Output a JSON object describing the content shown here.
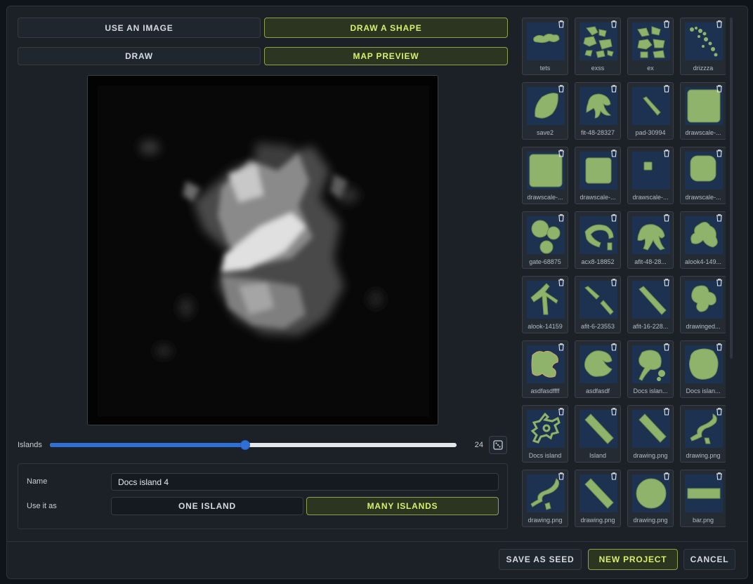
{
  "source_tabs": [
    {
      "label": "USE AN IMAGE",
      "active": false
    },
    {
      "label": "DRAW A SHAPE",
      "active": true
    }
  ],
  "mode_tabs": [
    {
      "label": "DRAW",
      "active": false
    },
    {
      "label": "MAP PREVIEW",
      "active": true
    }
  ],
  "slider": {
    "label": "Islands",
    "value": "24",
    "fill_fraction": 0.48
  },
  "form": {
    "name_label": "Name",
    "name_value": "Docs island 4",
    "use_label": "Use it as",
    "options": [
      {
        "label": "ONE ISLAND",
        "active": false
      },
      {
        "label": "MANY ISLANDS",
        "active": true
      }
    ]
  },
  "gallery": [
    {
      "label": "tets",
      "shape": "tets"
    },
    {
      "label": "exss",
      "shape": "scatter"
    },
    {
      "label": "ex",
      "shape": "scatter2"
    },
    {
      "label": "drizzza",
      "shape": "dots"
    },
    {
      "label": "save2",
      "shape": "leaf"
    },
    {
      "label": "fit-48-28327",
      "shape": "crab"
    },
    {
      "label": "pad-30994",
      "shape": "dash"
    },
    {
      "label": "drawscale-...",
      "shape": "squarebig"
    },
    {
      "label": "drawscale-...",
      "shape": "squarebig"
    },
    {
      "label": "drawscale-...",
      "shape": "squaremid"
    },
    {
      "label": "drawscale-...",
      "shape": "squaresmall"
    },
    {
      "label": "drawscale-...",
      "shape": "squareround"
    },
    {
      "label": "gate-68875",
      "shape": "circles"
    },
    {
      "label": "acx8-18852",
      "shape": "arc"
    },
    {
      "label": "afit-48-28...",
      "shape": "crab2"
    },
    {
      "label": "alook4-149...",
      "shape": "blob"
    },
    {
      "label": "alook-14159",
      "shape": "tree"
    },
    {
      "label": "afit-6-23553",
      "shape": "twolines"
    },
    {
      "label": "afit-16-228...",
      "shape": "diag"
    },
    {
      "label": "drawinged...",
      "shape": "blob2"
    },
    {
      "label": "asdfasdffff",
      "shape": "bird"
    },
    {
      "label": "asdfasdf",
      "shape": "bird2"
    },
    {
      "label": "Docs islan...",
      "shape": "ring"
    },
    {
      "label": "Docs islan...",
      "shape": "blob3"
    },
    {
      "label": "Docs island",
      "shape": "spiral"
    },
    {
      "label": "Island",
      "shape": "diagthick"
    },
    {
      "label": "drawing.png",
      "shape": "diagthick2"
    },
    {
      "label": "drawing.png",
      "shape": "squiggle"
    },
    {
      "label": "drawing.png",
      "shape": "squiggle2"
    },
    {
      "label": "drawing.png",
      "shape": "diagthick"
    },
    {
      "label": "drawing.png",
      "shape": "bigcircle"
    },
    {
      "label": "bar.png",
      "shape": "bar"
    }
  ],
  "footer": {
    "save_seed": "SAVE AS SEED",
    "new_project": "NEW PROJECT",
    "cancel": "CANCEL"
  },
  "colors": {
    "accent_green": "#d8f06b",
    "island_fill": "#8fb36a",
    "water": "#1d3250",
    "slider_blue": "#2f6fd8"
  }
}
